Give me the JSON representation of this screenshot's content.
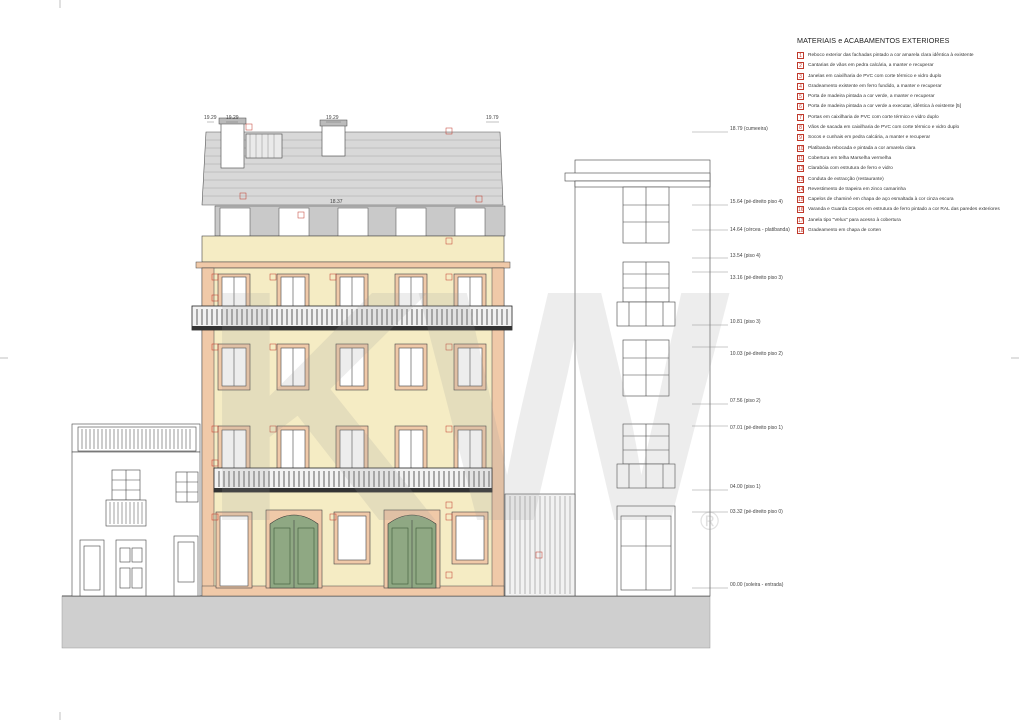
{
  "legend": {
    "title": "MATERIAIS e ACABAMENTOS EXTERIORES",
    "items": [
      {
        "num": "1",
        "text": "Reboco exterior das fachadas pintado a cor amarela clara idêntica à existente"
      },
      {
        "num": "2",
        "text": "Cantarias de vãos em pedra calcária, a manter e recuperar"
      },
      {
        "num": "3",
        "text": "Janelas em caixilharia de PVC com corte térmico e vidro duplo"
      },
      {
        "num": "4",
        "text": "Gradeamento existente em ferro fundido, a manter e recuperar"
      },
      {
        "num": "5",
        "text": "Porta de madeira pintada a cor verde, a manter e recuperar"
      },
      {
        "num": "6",
        "text": "Porta de madeira pintada a cor verde a executar, idêntica à existente [5]"
      },
      {
        "num": "7",
        "text": "Portas em caixilharia de PVC com corte térmico e vidro duplo"
      },
      {
        "num": "8",
        "text": "Vãos de sacada em caixilharia de PVC com corte térmico e vidro duplo"
      },
      {
        "num": "9",
        "text": "Socos e cunhais em pedra calcária, a manter e recuperar"
      },
      {
        "num": "10",
        "text": "Platibanda rebocada e pintada a cor amarela clara"
      },
      {
        "num": "11",
        "text": "Cobertura em telha Marselha vermelha"
      },
      {
        "num": "12",
        "text": "Clarabóia com estrutura de ferro e vidro"
      },
      {
        "num": "13",
        "text": "Conduta de extracção (restaurante)"
      },
      {
        "num": "14",
        "text": "Revestimento de trapeira em zinco camarinha"
      },
      {
        "num": "15",
        "text": "Capelos de chaminé em chapa de aço esmaltada à cor cinza escura"
      },
      {
        "num": "16",
        "text": "Varanda e Guarda Corpos em estrutura de ferro pintado a cor RAL das paredes exteriores"
      },
      {
        "num": "17",
        "text": "Janela tipo \"Velux\" para acesso à cobertura"
      },
      {
        "num": "18",
        "text": "Gradeamento em chapa de corten"
      }
    ]
  },
  "levels": [
    {
      "id": "cumeeira",
      "label": "18.79 (cumeeira)"
    },
    {
      "id": "pe-direito-piso4",
      "label": "15.64 (pé-direito piso 4)"
    },
    {
      "id": "platibanda",
      "label": "14.64 (cércea - platibanda)"
    },
    {
      "id": "piso4",
      "label": "13.54 (piso 4)"
    },
    {
      "id": "pe-direito-piso3",
      "label": "13.16 (pé-direito piso 3)"
    },
    {
      "id": "piso3",
      "label": "10.81 (piso 3)"
    },
    {
      "id": "pe-direito-piso2",
      "label": "10.03 (pé-direito piso 2)"
    },
    {
      "id": "piso2",
      "label": "07.56 (piso 2)"
    },
    {
      "id": "pe-direito-piso1",
      "label": "07.01 (pé-direito piso 1)"
    },
    {
      "id": "piso1",
      "label": "04.00 (piso 1)"
    },
    {
      "id": "pe-direito-piso0",
      "label": "03.32 (pé-direito piso 0)"
    },
    {
      "id": "soleira",
      "label": "00.00 (soleira - entrada)"
    }
  ],
  "roof_heights": {
    "left_a": "19.29",
    "left_b": "19.29",
    "center_chimney": "19.29",
    "mid": "18.37",
    "right": "19.79"
  },
  "watermark": {
    "text": "KW",
    "mark": "®"
  },
  "colors": {
    "facade": "#f5ecc4",
    "stone": "#f0c9a8",
    "roof": "#d8d8d8",
    "door_green": "#8fa883",
    "tag_red": "#c0392b"
  }
}
